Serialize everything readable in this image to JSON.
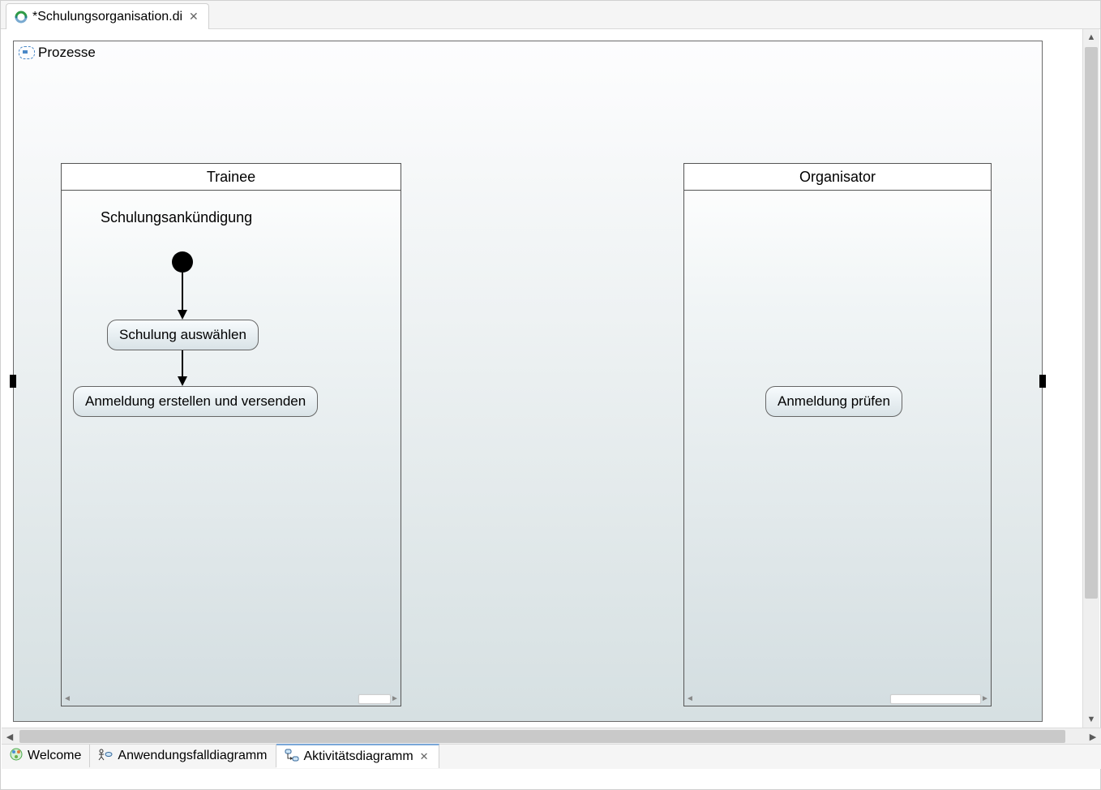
{
  "topTab": {
    "title": "*Schulungsorganisation.di"
  },
  "bottomTabs": {
    "welcome": "Welcome",
    "usecase": "Anwendungsfalldiagramm",
    "activity": "Aktivitätsdiagramm"
  },
  "diagram": {
    "frameTitle": "Prozesse",
    "partitions": {
      "trainee": {
        "title": "Trainee",
        "signalLabel": "Schulungsankündigung",
        "action1": "Schulung auswählen",
        "action2": "Anmeldung erstellen und versenden"
      },
      "organisator": {
        "title": "Organisator",
        "action1": "Anmeldung prüfen"
      }
    }
  }
}
